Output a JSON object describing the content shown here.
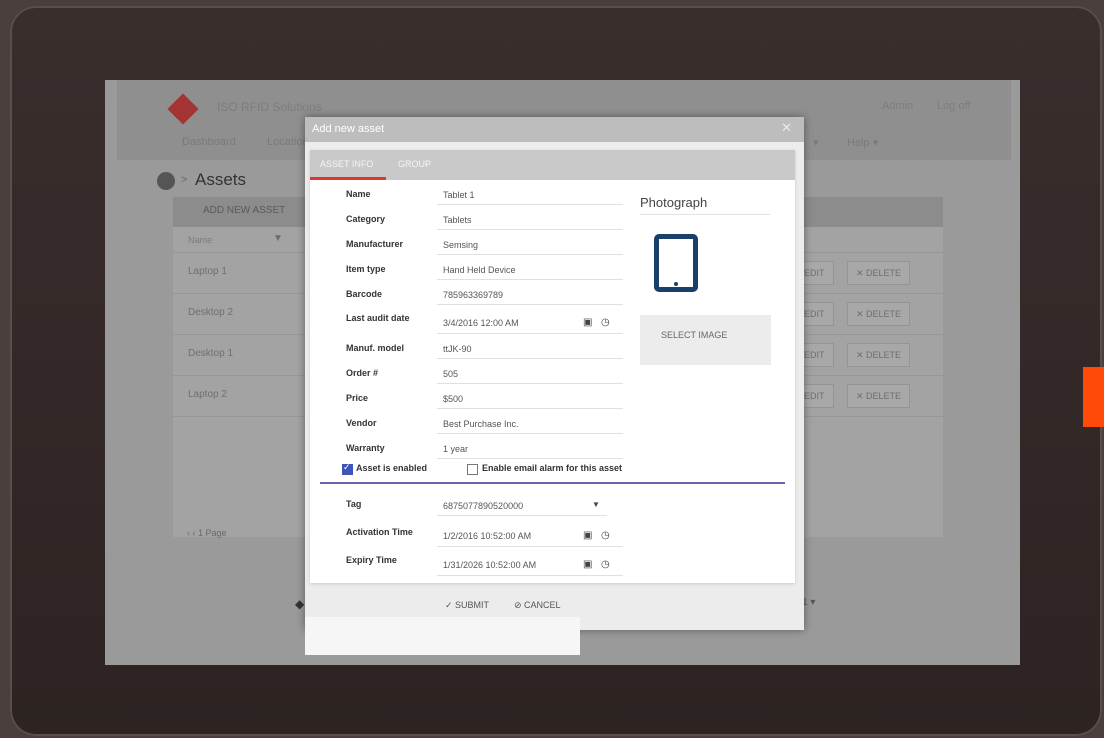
{
  "background_app": {
    "brand": "ISO RFID Solutions",
    "header_right": [
      "Admin",
      "Log off"
    ],
    "nav": [
      "Dashboard",
      "Locations"
    ],
    "nav_help": "Help ▾",
    "nav_partial": "▾",
    "page_title": "Assets",
    "chevron": ">",
    "add_new_asset": "ADD NEW ASSET",
    "filter_label": "Name",
    "rows": [
      "Laptop 1",
      "Desktop 2",
      "Desktop 1",
      "Laptop 2"
    ],
    "edit_label": "EDIT",
    "delete_label": "✕ DELETE",
    "pager": "‹  ‹   1   Page",
    "page_size_suffix": "1 ▾"
  },
  "modal": {
    "title": "Add new asset",
    "close": "✕",
    "tabs": [
      "ASSET INFO",
      "GROUP"
    ],
    "fields": {
      "name": {
        "label": "Name",
        "value": "Tablet 1"
      },
      "category": {
        "label": "Category",
        "value": "Tablets"
      },
      "manufacturer": {
        "label": "Manufacturer",
        "value": "Semsing"
      },
      "item_type": {
        "label": "Item type",
        "value": "Hand Held Device"
      },
      "barcode": {
        "label": "Barcode",
        "value": "785963369789"
      },
      "last_audit_date": {
        "label": "Last audit date",
        "value": "3/4/2016 12:00 AM"
      },
      "manuf_model": {
        "label": "Manuf. model",
        "value": "ttJK-90"
      },
      "order": {
        "label": "Order #",
        "value": "505"
      },
      "price": {
        "label": "Price",
        "value": "$500"
      },
      "vendor": {
        "label": "Vendor",
        "value": "Best Purchase Inc."
      },
      "warranty": {
        "label": "Warranty",
        "value": "1 year"
      },
      "tag": {
        "label": "Tag",
        "value": "6875077890520000"
      },
      "activation_time": {
        "label": "Activation Time",
        "value": "1/2/2016 10:52:00 AM"
      },
      "expiry_time": {
        "label": "Expiry Time",
        "value": "1/31/2026 10:52:00 AM"
      }
    },
    "asset_enabled": {
      "label": "Asset is enabled",
      "checked": true
    },
    "email_alarm": {
      "label": "Enable email alarm for this asset",
      "checked": false
    },
    "photograph_label": "Photograph",
    "select_image": "SELECT IMAGE",
    "submit": "✓ SUBMIT",
    "cancel": "⊘ CANCEL"
  },
  "colors": {
    "accent_orange": "#ff4a0a",
    "tab_active": "#e2382c",
    "divider": "#6f63b0",
    "tablet_icon": "#1b3f6b"
  },
  "icons": [
    "calendar-icon",
    "clock-icon",
    "dropdown-icon",
    "tablet-icon",
    "home-icon",
    "filter-icon"
  ]
}
